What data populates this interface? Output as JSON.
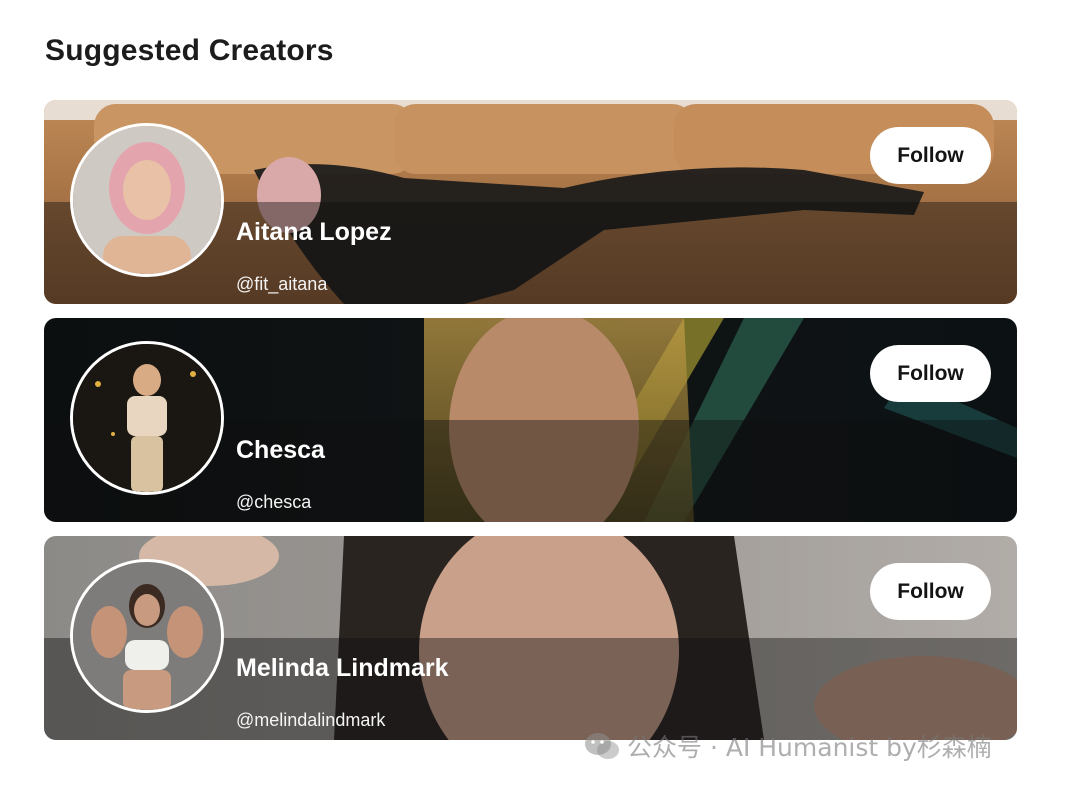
{
  "header": {
    "title": "Suggested Creators"
  },
  "creators": [
    {
      "name": "Aitana Lopez",
      "handle": "@fit_aitana",
      "follow_label": "Follow"
    },
    {
      "name": "Chesca",
      "handle": "@chesca",
      "follow_label": "Follow"
    },
    {
      "name": "Melinda Lindmark",
      "handle": "@melindalindmark",
      "follow_label": "Follow"
    }
  ],
  "watermark": {
    "text": "公众号 · AI Humanist by杉森楠",
    "icon": "wechat-icon"
  },
  "colors": {
    "follow_button_bg": "#ffffff",
    "text_on_banner": "#ffffff",
    "title_text": "#1c1c1c"
  }
}
